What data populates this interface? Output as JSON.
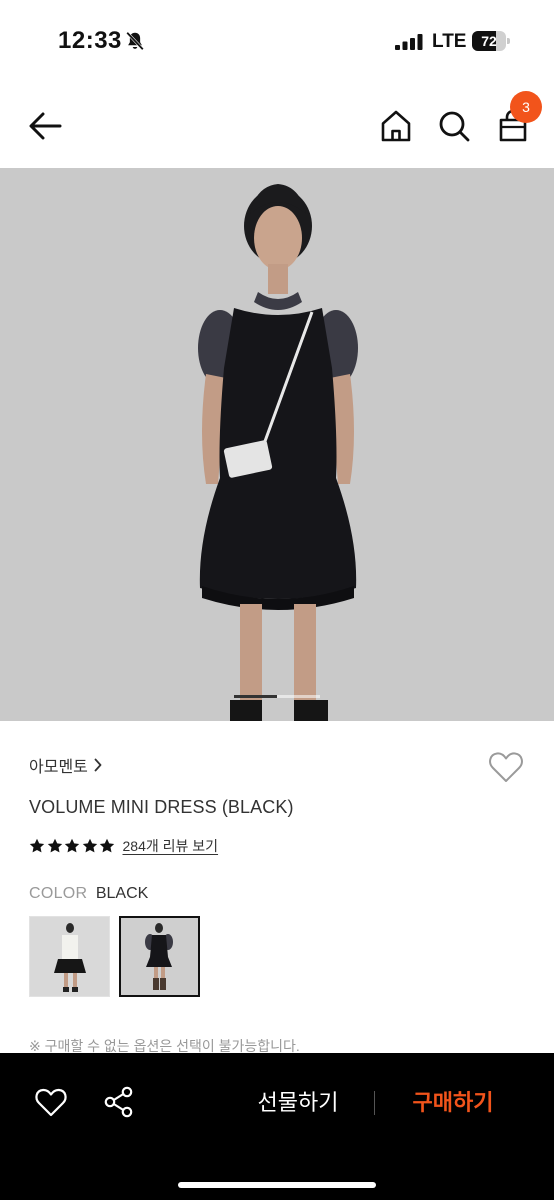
{
  "status_bar": {
    "time": "12:33",
    "network": "LTE",
    "battery_percent": "72",
    "battery_level": 0.72
  },
  "header": {
    "icons": [
      "back-arrow-icon",
      "home-icon",
      "search-icon",
      "shopping-bag-icon"
    ],
    "cart_count": "3"
  },
  "gallery": {
    "current_index": 1,
    "total": 2
  },
  "product": {
    "brand": "아모멘토",
    "title": "VOLUME MINI DRESS (BLACK)",
    "rating_stars": 5,
    "review_link": "284개 리뷰 보기",
    "color_label": "COLOR",
    "color_value": "BLACK",
    "swatches": [
      {
        "name": "ivory",
        "selected": false
      },
      {
        "name": "black",
        "selected": true
      }
    ],
    "notice": "※ 구매할 수 없는 옵션은 선택이 불가능합니다."
  },
  "bottom_bar": {
    "gift_label": "선물하기",
    "buy_label": "구매하기"
  },
  "colors": {
    "accent": "#f2541b",
    "bottom_bar_bg": "#000000",
    "hero_bg": "#c8c8c8"
  }
}
